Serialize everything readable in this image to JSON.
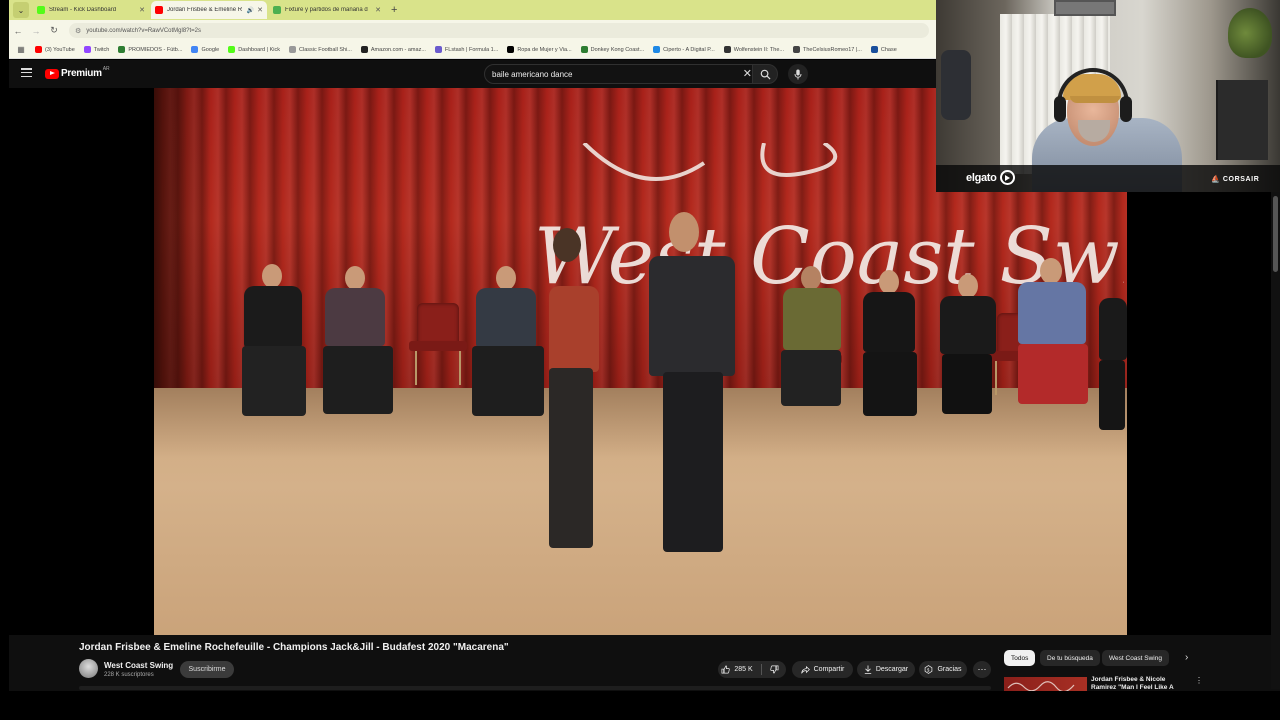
{
  "browser": {
    "tabs": [
      {
        "title": "Stream - Kick Dashboard",
        "favicon_color": "#53fc18",
        "active": false,
        "audio": false
      },
      {
        "title": "Jordan Frisbee & Emeline R",
        "favicon_color": "#ff0000",
        "active": true,
        "audio": true
      },
      {
        "title": "Fixture y partidos de mañana d",
        "favicon_color": "#4caf50",
        "active": false,
        "audio": false
      }
    ],
    "url": "youtube.com/watch?v=RawVCotMgl8?t=2s",
    "bookmarks": [
      {
        "label": "(3) YouTube",
        "color": "#ff0000"
      },
      {
        "label": "Twitch",
        "color": "#9146ff"
      },
      {
        "label": "PROMIEDOS - Fútb...",
        "color": "#2e7d32"
      },
      {
        "label": "Google",
        "color": "#4285f4"
      },
      {
        "label": "Dashboard | Kick",
        "color": "#53fc18"
      },
      {
        "label": "Classic Football Shi...",
        "color": "#999999"
      },
      {
        "label": "Amazon.com - amaz...",
        "color": "#222222"
      },
      {
        "label": "FLstash | Formula 1...",
        "color": "#6a5acd"
      },
      {
        "label": "Ropa de Mujer y Via...",
        "color": "#000000"
      },
      {
        "label": "Donkey Kong Coast...",
        "color": "#2e7d32"
      },
      {
        "label": "Ciperto - A Digital P...",
        "color": "#1e88e5"
      },
      {
        "label": "Wolfenstein II: The...",
        "color": "#333333"
      },
      {
        "label": "TheCelsiusRomeo17 |...",
        "color": "#444444"
      },
      {
        "label": "Chase",
        "color": "#1a4f9c"
      }
    ]
  },
  "youtube": {
    "logo_text": "Premium",
    "region": "AR",
    "search": {
      "value": "baile americano dance"
    }
  },
  "video": {
    "banner_text": "West Coast Swing",
    "title": "Jordan Frisbee & Emeline Rochefeuille - Champions Jack&Jill - Budafest 2020 \"Macarena\"",
    "channel": {
      "name": "West Coast Swing",
      "subscribers": "228 K suscriptores"
    },
    "subscribe_label": "Suscribirme",
    "likes": "285 K",
    "share_label": "Compartir",
    "download_label": "Descargar",
    "thanks_label": "Gracias",
    "more_label": "⋯"
  },
  "sidebar": {
    "chips": [
      {
        "label": "Todos",
        "selected": true
      },
      {
        "label": "De tu búsqueda",
        "selected": false
      },
      {
        "label": "West Coast Swing",
        "selected": false
      }
    ],
    "recommendation": {
      "title": "Jordan Frisbee & Nicole Ramirez \"Man I Feel Like A"
    }
  },
  "webcam": {
    "brand_left": "elgato",
    "brand_right": "CORSAIR"
  }
}
